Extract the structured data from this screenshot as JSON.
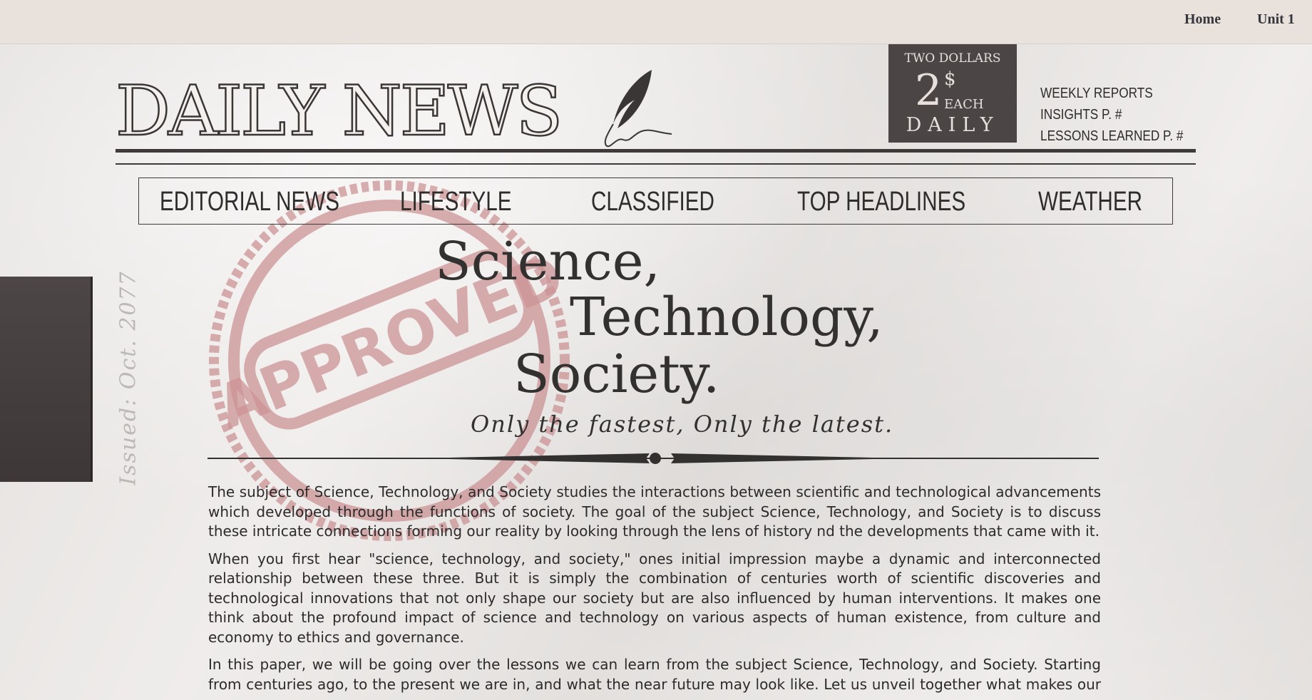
{
  "nav": {
    "home": "Home",
    "unit": "Unit 1"
  },
  "masthead": {
    "title": "DAILY NEWS"
  },
  "price": {
    "top": "TWO DOLLARS",
    "amount": "2",
    "symbol": "$",
    "each": "EACH",
    "frequency": "DAILY"
  },
  "side_links": [
    "WEEKLY REPORTS",
    "INSIGHTS P. #",
    "LESSONS LEARNED P. #"
  ],
  "categories": [
    "EDITORIAL NEWS",
    "LIFESTYLE",
    "CLASSIFIED",
    "TOP HEADLINES",
    "WEATHER"
  ],
  "stamp": {
    "text": "APPROVED"
  },
  "issued": "Issued: Oct. 2077",
  "headline": {
    "line1": "Science,",
    "line2": "Technology,",
    "line3": "Society."
  },
  "tagline": "Only the fastest, Only the latest.",
  "article": {
    "paragraphs": [
      "The subject of Science, Technology, and Society studies the interactions between scientific and technological advancements which developed through the functions of society. The goal of the subject Science, Technology, and Society is to discuss these intricate connections forming our reality by looking through the lens of history nd the developments that came with it.",
      "When you first hear \"science, technology, and society,\" ones initial impression maybe a dynamic and interconnected relationship between these three. But it is simply the combination of centuries worth of scientific discoveries and technological innovations that not only shape our society but are also influenced by human interventions. It makes one think about the profound impact of science and technology on various aspects of human existence, from culture and economy to ethics and governance.",
      "In this paper, we will be going over the lessons we can learn from the subject Science, Technology, and Society. Starting from centuries ago, to the present we are in, and what the near future may look like. Let us unveil together what makes our very"
    ]
  },
  "colors": {
    "ink": "#2e2b2b",
    "paper": "#ebe8e6",
    "stamp": "#c98a8c",
    "price_box": "#4c4545"
  },
  "icons": {
    "quill": "quill-icon",
    "divider": "ornamental-divider"
  }
}
